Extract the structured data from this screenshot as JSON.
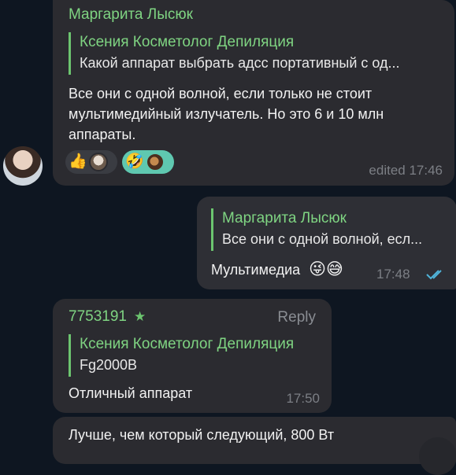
{
  "messages": {
    "m1": {
      "sender": "Маргарита Лысюк",
      "reply_name": "Ксения Косметолог Депиляция",
      "reply_text": "Какой аппарат выбрать адсс портативный с од...",
      "text": "Все они с одной волной, если только не стоит мультимедийный излучатель. Но это 6 и 10 млн аппараты.",
      "time": "edited 17:46",
      "reactions": [
        {
          "emoji": "👍",
          "avatar_color": "#c9b8a8"
        },
        {
          "emoji": "🤣",
          "avatar_color": "#8a5a3a"
        }
      ]
    },
    "m2": {
      "reply_name": "Маргарита Лысюк",
      "reply_text": "Все они с одной волной, есл...",
      "text": "Мультимедиа",
      "emojis": "😜😅",
      "time": "17:48",
      "status_icon": "double-check-icon"
    },
    "m3": {
      "sender": "7753191",
      "sender_badge_icon": "star-icon",
      "reply_label": "Reply",
      "reply_name": "Ксения Косметолог Депиляция",
      "reply_text": "Fg2000B",
      "text": "Отличный аппарат",
      "time": "17:50"
    },
    "m4": {
      "text": "Лучше, чем который следующий, 800 Вт"
    }
  },
  "colors": {
    "background": "#0e1621",
    "bubble": "#2b2b30",
    "accent_green": "#7fd482",
    "check_blue": "#4fb3d9"
  }
}
